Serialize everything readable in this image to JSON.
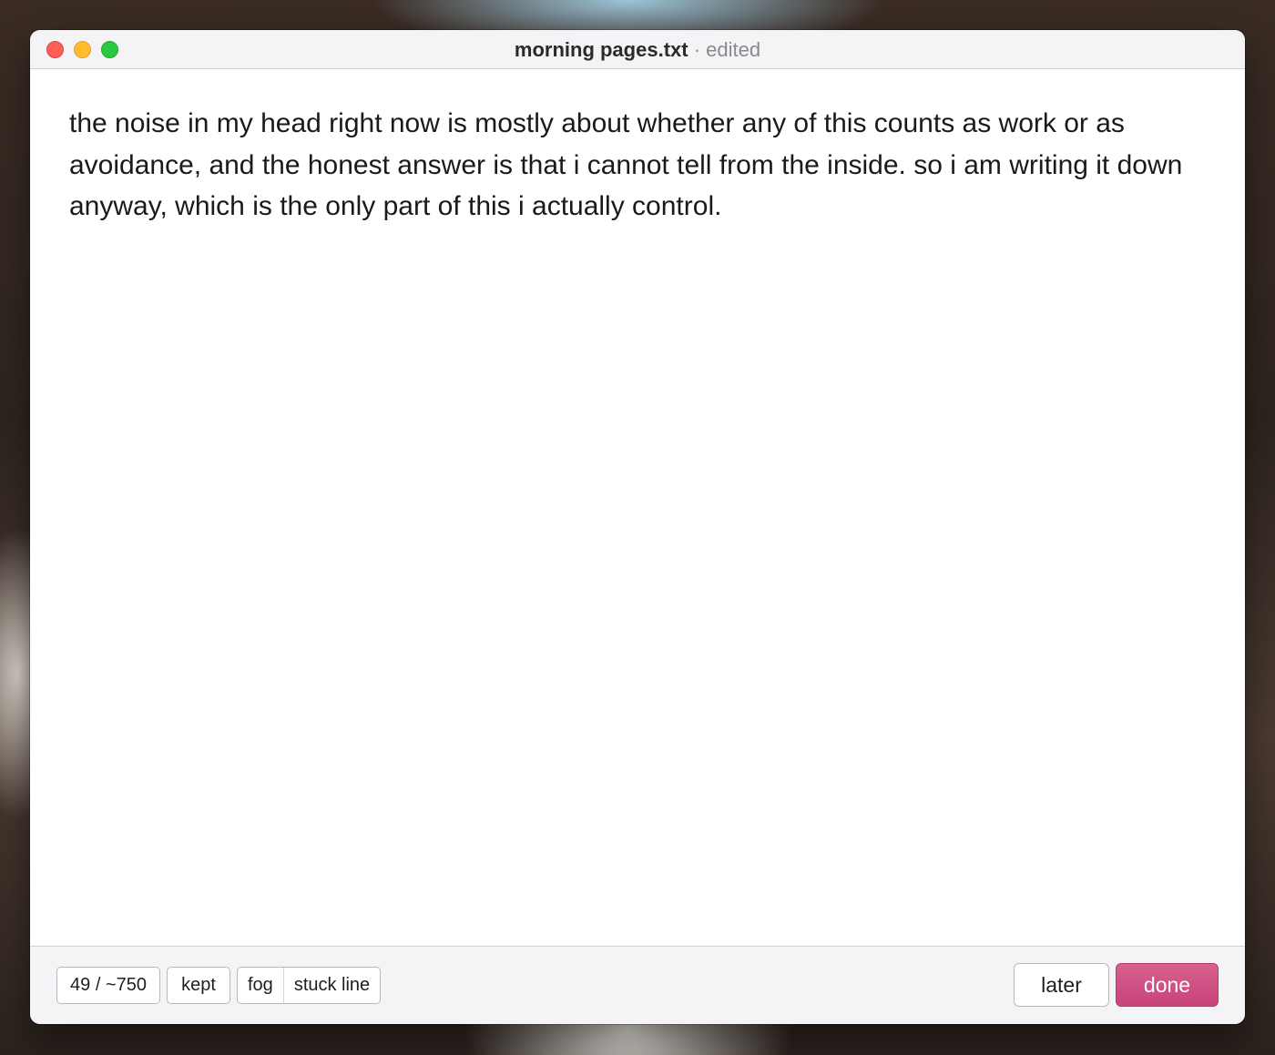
{
  "window": {
    "filename": "morning pages.txt",
    "separator": "·",
    "status": "edited"
  },
  "editor": {
    "text": "the noise in my head right now is mostly about whether any of this counts as work or as avoidance, and the honest answer is that i cannot tell from the inside. so i am writing it down anyway, which is the only part of this i actually control."
  },
  "footer": {
    "word_count": "49 / ~750",
    "kept_label": "kept",
    "tags": [
      "fog",
      "stuck line"
    ],
    "later_label": "later",
    "done_label": "done"
  },
  "colors": {
    "accent": "#cc4a7e",
    "close": "#fe5f57",
    "minimize": "#febc2e",
    "maximize": "#28c840"
  }
}
